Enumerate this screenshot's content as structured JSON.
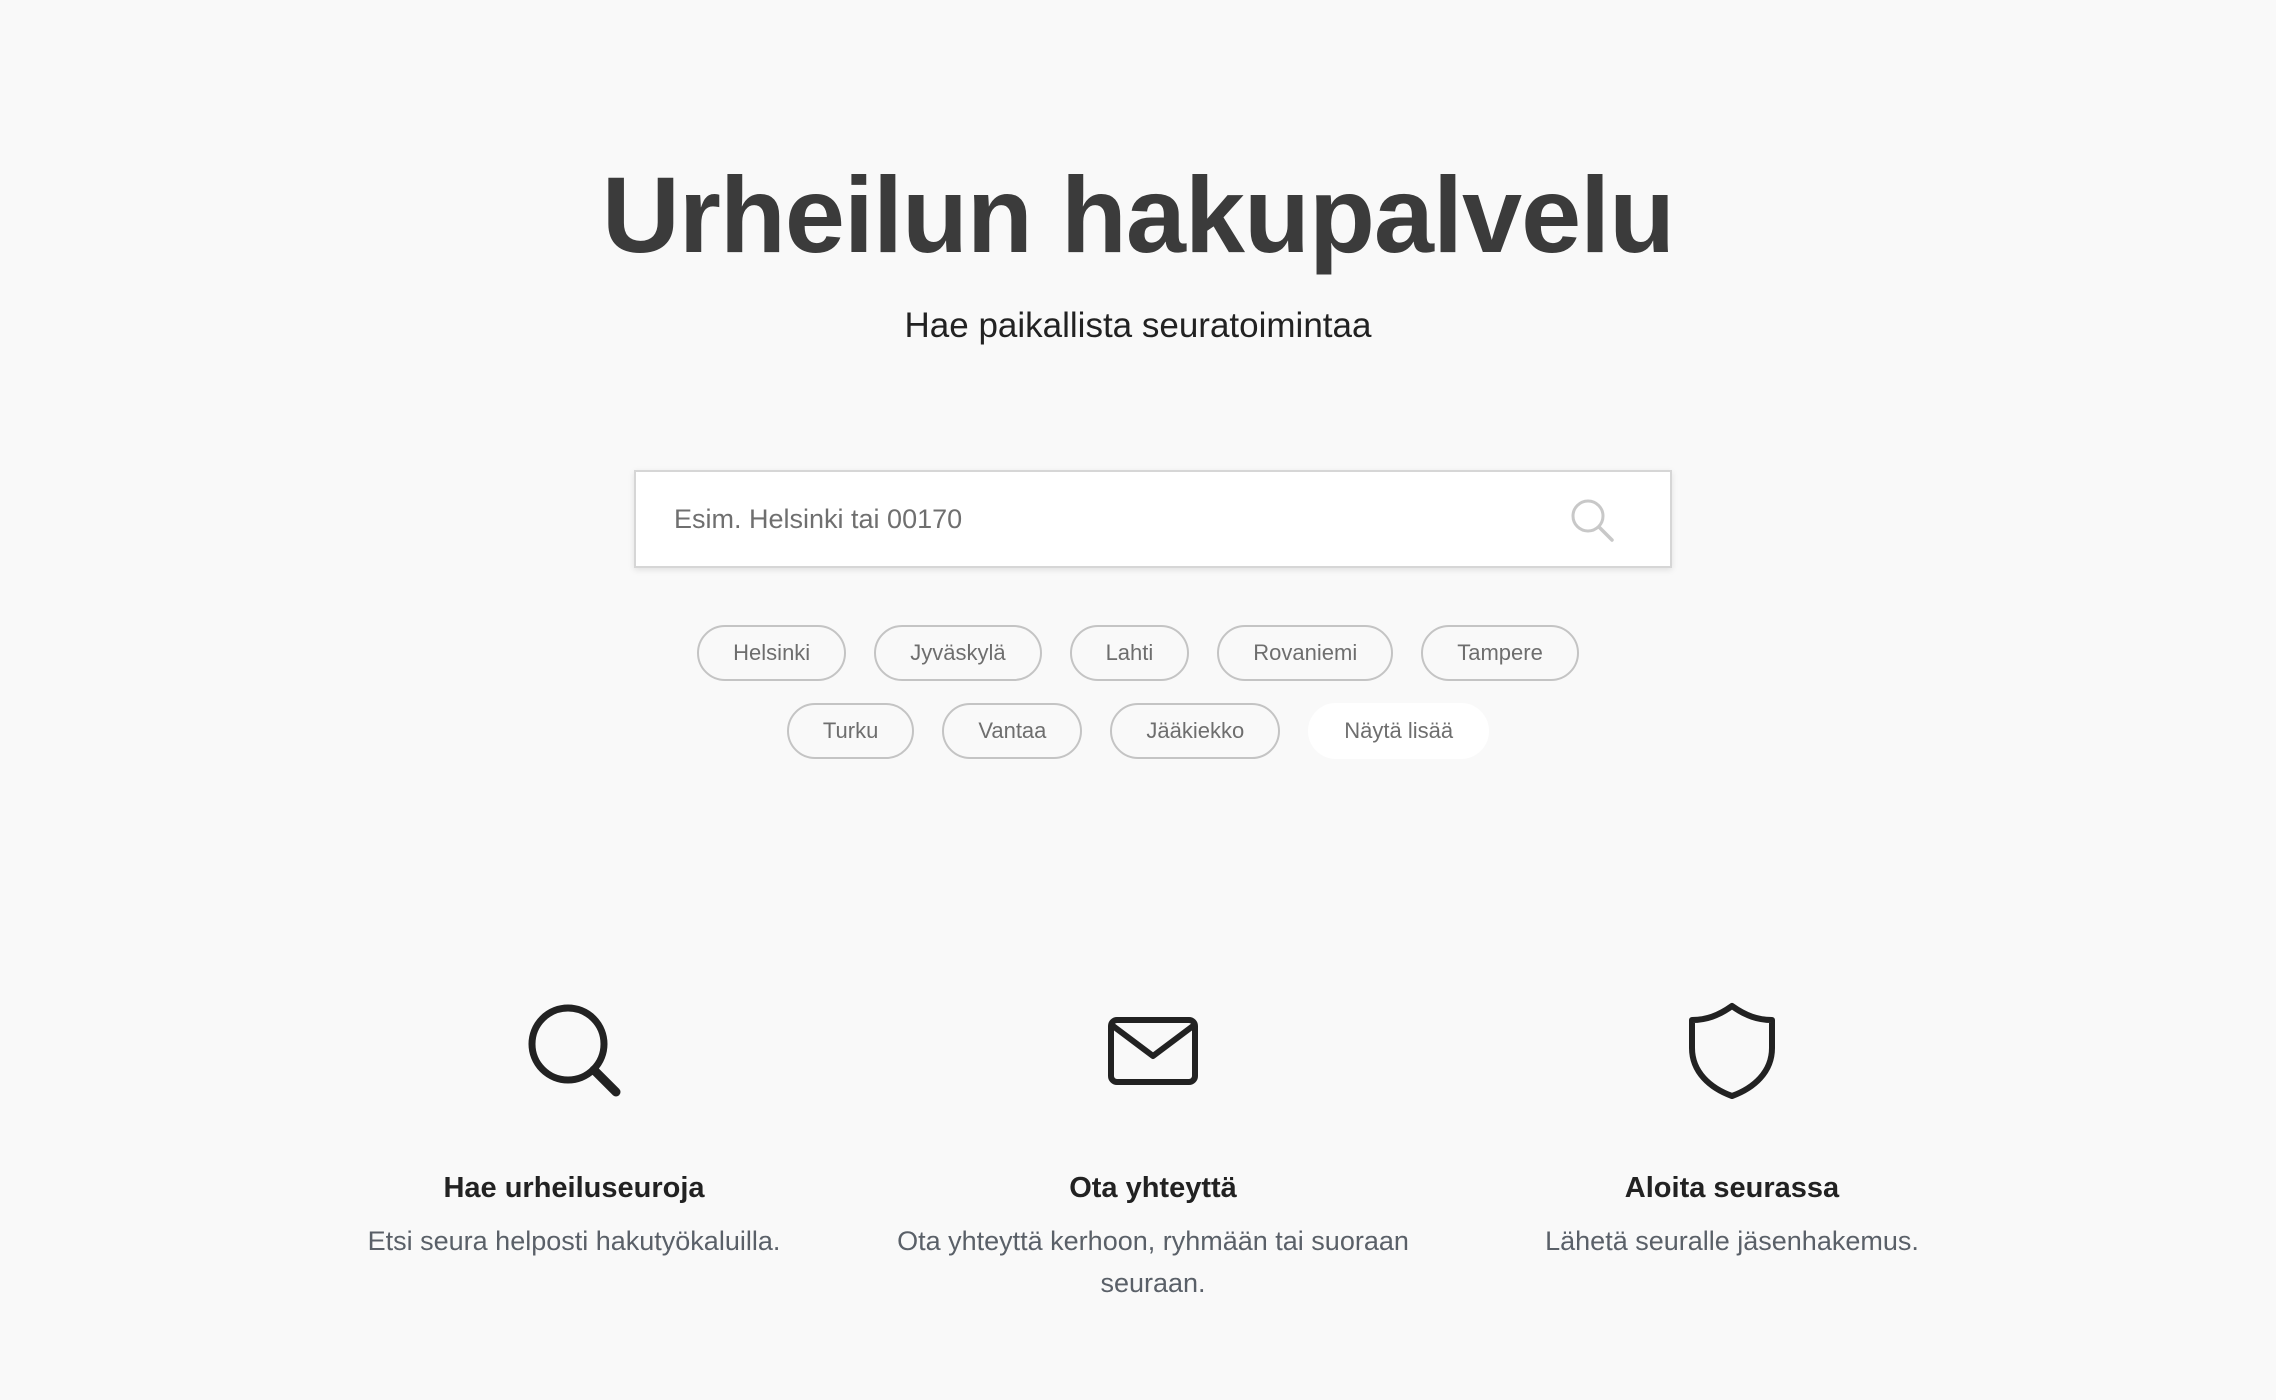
{
  "hero": {
    "title": "Urheilun hakupalvelu",
    "subtitle": "Hae paikallista seuratoimintaa"
  },
  "search": {
    "placeholder": "Esim. Helsinki tai 00170",
    "value": "",
    "icon": "search-icon"
  },
  "quick_filters": {
    "row1": [
      "Helsinki",
      "Jyväskylä",
      "Lahti",
      "Rovaniemi",
      "Tampere"
    ],
    "row2": [
      "Turku",
      "Vantaa",
      "Jääkiekko"
    ],
    "show_more_label": "Näytä lisää"
  },
  "features": [
    {
      "icon": "search-icon",
      "title": "Hae urheiluseuroja",
      "text": "Etsi seura helposti hakutyökaluilla."
    },
    {
      "icon": "envelope-icon",
      "title": "Ota yhteyttä",
      "text": "Ota yhteyttä kerhoon, ryhmään tai suoraan seuraan."
    },
    {
      "icon": "shield-icon",
      "title": "Aloita seurassa",
      "text": "Lähetä seuralle jäsenhakemus."
    }
  ],
  "colors": {
    "background": "#f9f9f9",
    "title": "#3b3b3b",
    "chip_border": "#c4c4c4",
    "muted_text": "#5a6068"
  }
}
